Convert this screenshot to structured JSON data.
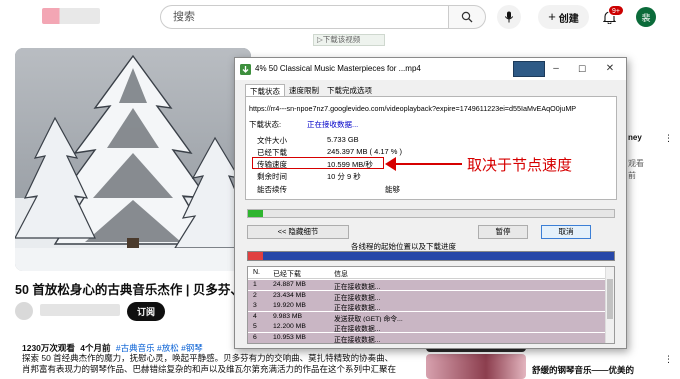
{
  "youtube": {
    "search_placeholder": "搜索",
    "create_label": "创建",
    "notification_count": "9+",
    "avatar_letter": "裴",
    "video_title": "50 首放松身心的古典音乐杰作 | 贝多芬、",
    "subscribe_label": "订阅",
    "views": "1230万次观看",
    "age": "4个月前",
    "tags": "#古典音乐 #放松 #钢琴",
    "desc_line1": "探索 50 首经典杰作的魔力，抚慰心灵，唤起平静感。贝多芬有力的交响曲、莫扎特精致的协奏曲、",
    "desc_line2": "肖邦富有表现力的钢琴作品、巴赫错综复杂的和声以及维瓦尔第充满活力的作品在这个系列中汇聚在",
    "right_frag_1": "ney",
    "right_frag_2": "观看",
    "right_frag_3": "前",
    "right_frag_4": "舒缓的钢琴音乐——优美的",
    "floating_bar": "▷下载该视频"
  },
  "dialog": {
    "title": "4% 50 Classical Music Masterpieces for ...mp4",
    "tabs": [
      "下载状态",
      "速度限制",
      "下载完成选项"
    ],
    "url": "https://rr4---sn-npoe7nz7.googlevideo.com/videoplayback?expire=1749611223ei=d55IaMvEAqO0juMP",
    "status": {
      "label": "下载状态:",
      "value": "正在接收数据..."
    },
    "fields": [
      {
        "label": "文件大小",
        "value": "5.733  GB"
      },
      {
        "label": "已经下载",
        "value": "245.397  MB  ( 4.17 % )"
      },
      {
        "label": "传输速度",
        "value": "10.599  MB/秒"
      },
      {
        "label": "剩余时间",
        "value": "10 分 9 秒"
      },
      {
        "label": "能否续传",
        "value": "能够"
      }
    ],
    "progress": 0.0417,
    "hide_details": "<< 隐藏细节",
    "pause": "暂停",
    "cancel": "取消",
    "segments_label": "各线程的起始位置以及下载进度",
    "table": {
      "headers": [
        "N.",
        "已经下载",
        "信息"
      ],
      "rows": [
        {
          "n": "1",
          "downloaded": "24.887  MB",
          "info": "正在接收数据..."
        },
        {
          "n": "2",
          "downloaded": "23.434  MB",
          "info": "正在接收数据..."
        },
        {
          "n": "3",
          "downloaded": "19.920  MB",
          "info": "正在接收数据..."
        },
        {
          "n": "4",
          "downloaded": "9.983  MB",
          "info": "发送获取 (GET) 命令..."
        },
        {
          "n": "5",
          "downloaded": "12.200  MB",
          "info": "正在接收数据..."
        },
        {
          "n": "6",
          "downloaded": "10.953  MB",
          "info": "正在接收数据..."
        }
      ]
    }
  },
  "annotation": "取决于节点速度",
  "colors": {
    "accent_red": "#d60000",
    "progress_green": "#2fb52f",
    "link_blue": "#065fd4"
  }
}
